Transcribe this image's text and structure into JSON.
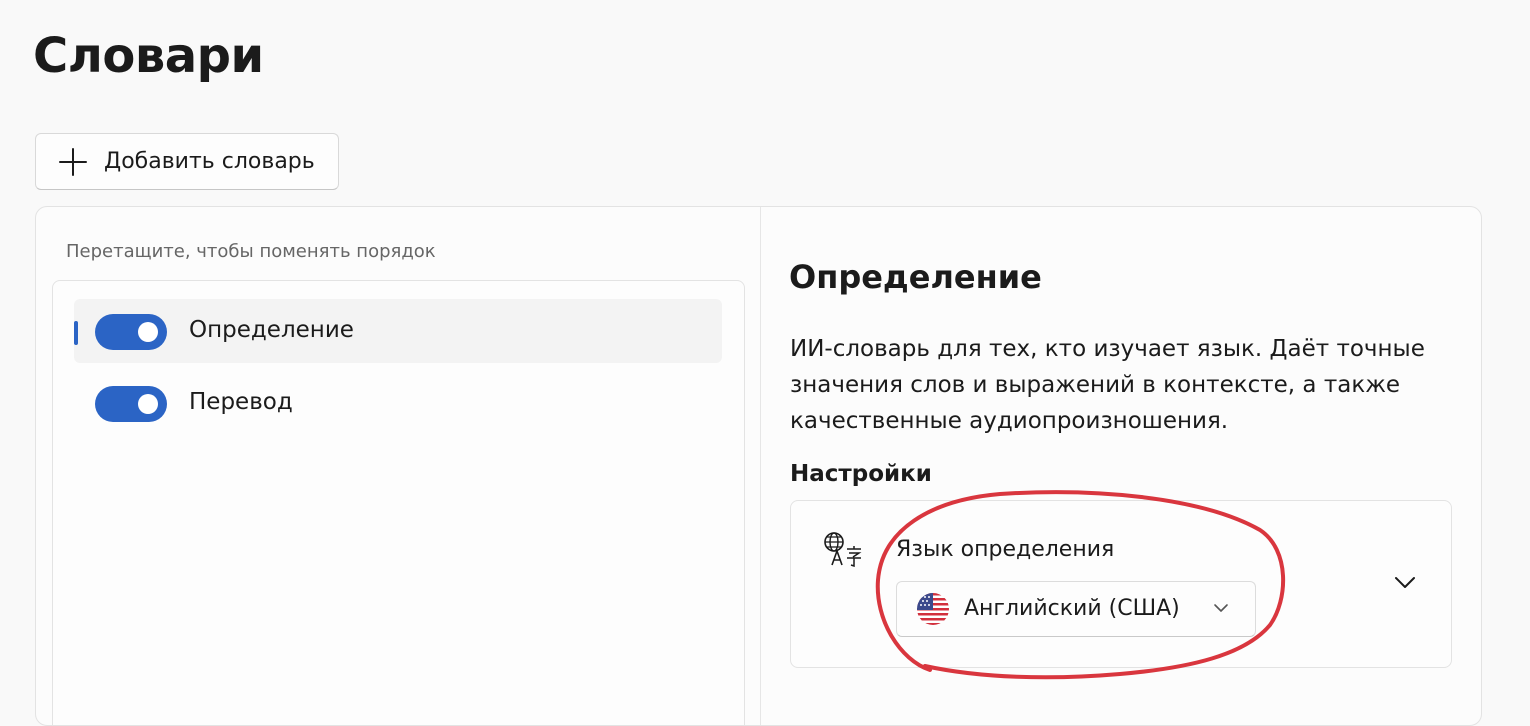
{
  "page": {
    "title": "Словари"
  },
  "toolbar": {
    "add_label": "Добавить словарь"
  },
  "list": {
    "hint": "Перетащите, чтобы поменять порядок",
    "items": [
      {
        "label": "Определение",
        "enabled": true,
        "selected": true
      },
      {
        "label": "Перевод",
        "enabled": true,
        "selected": false
      }
    ]
  },
  "detail": {
    "title": "Определение",
    "description": "ИИ-словарь для тех, кто изучает язык. Даёт точные значения слов и выражений в контексте, а также качественные аудиопроизношения.",
    "settings_title": "Настройки",
    "setting": {
      "label": "Язык определения",
      "icon": "language-icon",
      "selected_value": "Английский (США)",
      "flag": "us-flag-icon"
    }
  },
  "colors": {
    "accent": "#2b64c5",
    "annotation": "#d9363e",
    "background": "#f9f9f9"
  }
}
